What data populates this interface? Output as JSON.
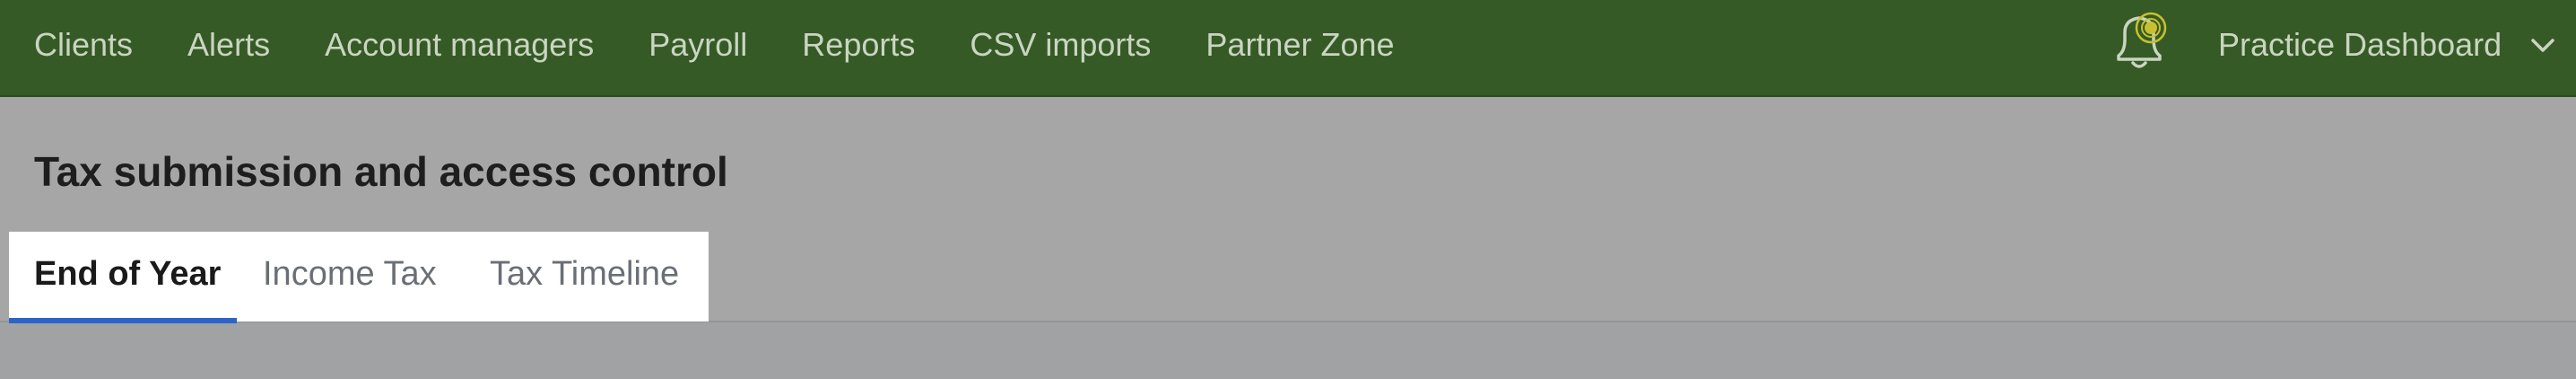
{
  "nav": {
    "items": [
      {
        "label": "Clients"
      },
      {
        "label": "Alerts"
      },
      {
        "label": "Account managers"
      },
      {
        "label": "Payroll"
      },
      {
        "label": "Reports"
      },
      {
        "label": "CSV imports"
      },
      {
        "label": "Partner Zone"
      }
    ],
    "notifications_icon": "bell-icon",
    "dashboard_label": "Practice Dashboard",
    "dropdown_icon": "chevron-down-icon"
  },
  "page": {
    "title": "Tax submission and access control"
  },
  "tabs": [
    {
      "label": "End of Year",
      "active": true
    },
    {
      "label": "Income Tax",
      "active": false
    },
    {
      "label": "Tax Timeline",
      "active": false
    }
  ],
  "colors": {
    "topbar": "#365a26",
    "nav_text": "#c9d5c1",
    "tab_accent": "#2d63c8",
    "notification_dot": "#c8c02e"
  }
}
